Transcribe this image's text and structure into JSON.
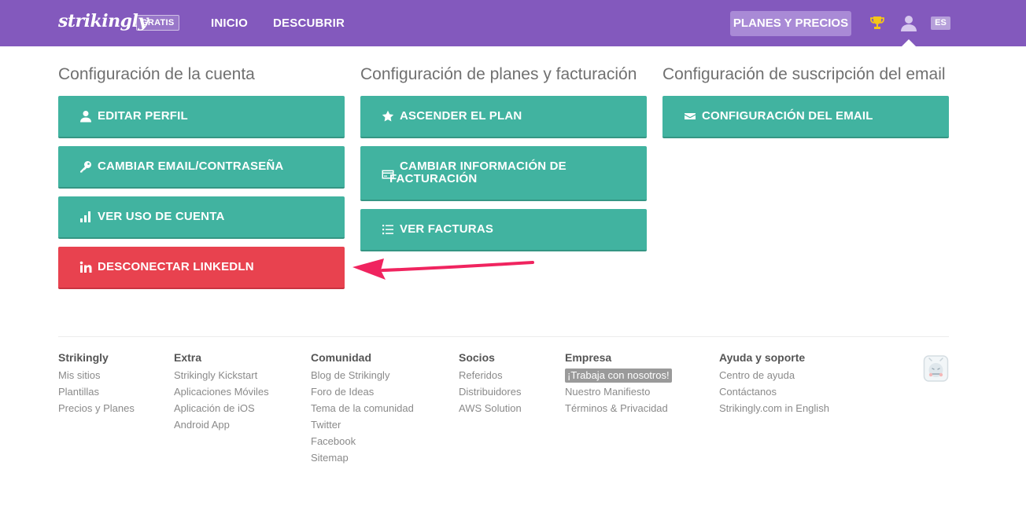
{
  "nav": {
    "logo": "strikingly",
    "plan_badge": "GRATIS",
    "links": [
      "INICIO",
      "DESCUBRIR"
    ],
    "plans_button": "PLANES Y PRECIOS",
    "language": "ES"
  },
  "sections": {
    "account": {
      "title": "Configuración de la cuenta",
      "buttons": [
        "EDITAR PERFIL",
        "CAMBIAR EMAIL/CONTRASEÑA",
        "VER USO DE CUENTA",
        "DESCONECTAR LINKEDLN"
      ]
    },
    "billing": {
      "title": "Configuración de planes y facturación",
      "buttons": [
        "ASCENDER EL PLAN",
        "CAMBIAR INFORMACIÓN DE FACTURACIÓN",
        "VER FACTURAS"
      ]
    },
    "email": {
      "title": "Configuración de suscripción del email",
      "buttons": [
        "CONFIGURACIÓN DEL EMAIL"
      ]
    }
  },
  "footer": {
    "strikingly": {
      "title": "Strikingly",
      "links": [
        "Mis sitios",
        "Plantillas",
        "Precios y Planes"
      ]
    },
    "extra": {
      "title": "Extra",
      "links": [
        "Strikingly Kickstart",
        "Aplicaciones Móviles",
        "Aplicación de iOS",
        "Android App"
      ]
    },
    "comunidad": {
      "title": "Comunidad",
      "links": [
        "Blog de Strikingly",
        "Foro de Ideas",
        "Tema de la comunidad",
        "Twitter",
        "Facebook",
        "Sitemap"
      ]
    },
    "socios": {
      "title": "Socios",
      "links": [
        "Referidos",
        "Distribuidores",
        "AWS Solution"
      ]
    },
    "empresa": {
      "title": "Empresa",
      "badge": "¡Trabaja con nosotros!",
      "links": [
        "Nuestro Manifiesto",
        "Términos & Privacidad"
      ]
    },
    "ayuda": {
      "title": "Ayuda y soporte",
      "links": [
        "Centro de ayuda",
        "Contáctanos",
        "Strikingly.com in English"
      ]
    }
  },
  "colors": {
    "nav_purple": "#8359bd",
    "teal_button": "#41b3a0",
    "red_button": "#e8424f",
    "arrow": "#f0245f"
  },
  "icons": {
    "nav": [
      "trophy-icon",
      "user-icon"
    ],
    "account": [
      "user-icon",
      "key-icon",
      "bar-chart-icon",
      "linkedin-icon"
    ],
    "billing": [
      "star-icon",
      "credit-card-icon",
      "list-icon"
    ],
    "email": [
      "envelope-icon"
    ]
  }
}
